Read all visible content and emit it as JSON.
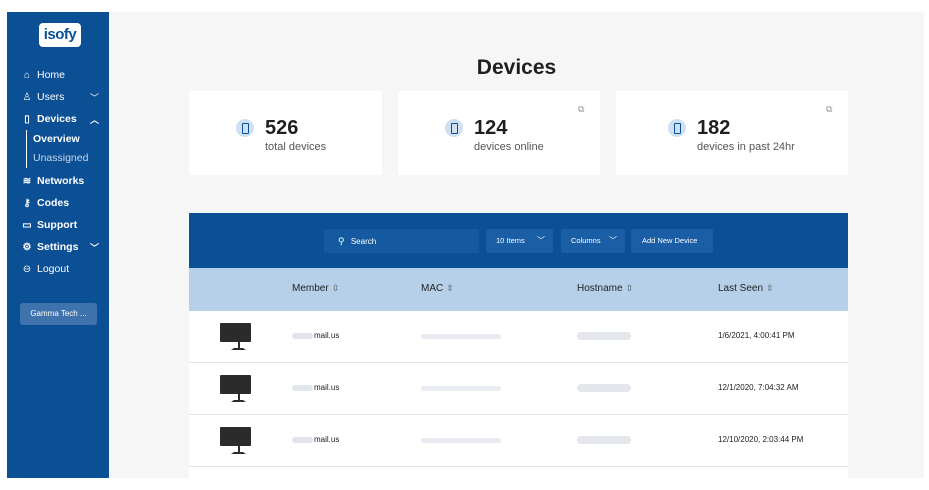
{
  "sidebar": {
    "logo": "isofy",
    "items": [
      {
        "label": "Home",
        "icon": "home-icon"
      },
      {
        "label": "Users",
        "icon": "user-icon"
      },
      {
        "label": "Devices",
        "icon": "device-icon"
      },
      {
        "label": "Networks",
        "icon": "wifi-icon"
      },
      {
        "label": "Codes",
        "icon": "key-icon"
      },
      {
        "label": "Support",
        "icon": "ticket-icon"
      },
      {
        "label": "Settings",
        "icon": "gear-icon"
      },
      {
        "label": "Logout",
        "icon": "logout-icon"
      }
    ],
    "devices_sub": [
      {
        "label": "Overview"
      },
      {
        "label": "Unassigned"
      }
    ],
    "org_button": "Gamma Tech ..."
  },
  "page": {
    "title": "Devices"
  },
  "stats": [
    {
      "value": "526",
      "label": "total devices"
    },
    {
      "value": "124",
      "label": "devices online"
    },
    {
      "value": "182",
      "label": "devices in past 24hr"
    }
  ],
  "toolbar": {
    "search_placeholder": "Search",
    "items_select": "10 Items",
    "columns_button": "Columns",
    "add_button": "Add New Device"
  },
  "table": {
    "columns": [
      "Member",
      "MAC",
      "Hostname",
      "Last Seen"
    ],
    "rows": [
      {
        "member": "mail.us",
        "last_seen": "1/6/2021, 4:00:41 PM"
      },
      {
        "member": "mail.us",
        "last_seen": "12/1/2020, 7:04:32 AM"
      },
      {
        "member": "mail.us",
        "last_seen": "12/10/2020, 2:03:44 PM"
      }
    ]
  },
  "colors": {
    "brand": "#0b4f95",
    "header_row": "#b7d0ea",
    "background": "#f6f6f6"
  }
}
